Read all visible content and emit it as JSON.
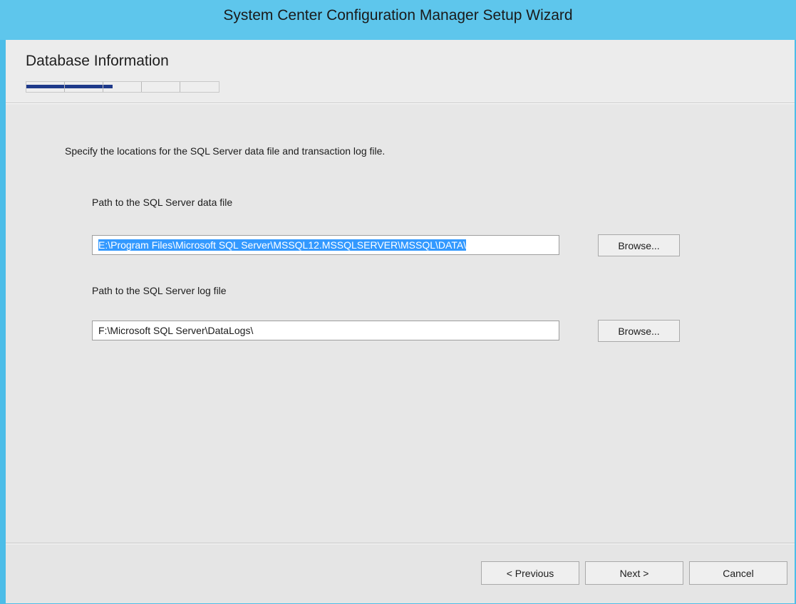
{
  "window": {
    "title": "System Center Configuration Manager Setup Wizard"
  },
  "header": {
    "heading": "Database Information",
    "progress": {
      "total_steps": 5,
      "completed_fraction": 0.45
    }
  },
  "content": {
    "instruction": "Specify the locations for the SQL Server data file and transaction log file.",
    "data_file": {
      "label": "Path to the SQL Server data file",
      "value": "E:\\Program Files\\Microsoft SQL Server\\MSSQL12.MSSQLSERVER\\MSSQL\\DATA\\",
      "selected": true,
      "browse_label": "Browse..."
    },
    "log_file": {
      "label": "Path to the SQL Server log file",
      "value": "F:\\Microsoft SQL Server\\DataLogs\\",
      "selected": false,
      "browse_label": "Browse..."
    }
  },
  "footer": {
    "previous_label": "< Previous",
    "next_label": "Next >",
    "cancel_label": "Cancel"
  },
  "colors": {
    "titlebar": "#5ec6ec",
    "progress_fill": "#1f3a8a",
    "selection": "#3399ff"
  }
}
